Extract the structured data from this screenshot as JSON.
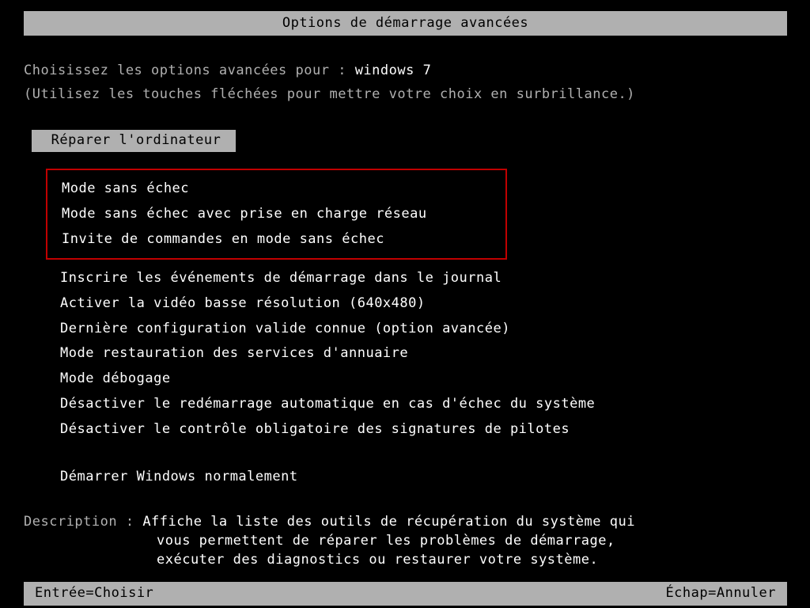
{
  "title": "Options de démarrage avancées",
  "prompt_prefix": "Choisissez les options avancées pour :",
  "os_name": "windows 7",
  "hint": "(Utilisez les touches fléchées pour mettre votre choix en surbrillance.)",
  "repair": "Réparer l'ordinateur",
  "group1": {
    "opt0": "Mode sans échec",
    "opt1": "Mode sans échec avec prise en charge réseau",
    "opt2": "Invite de commandes en mode sans échec"
  },
  "group2": {
    "opt0": "Inscrire les événements de démarrage dans le journal",
    "opt1": "Activer la vidéo basse résolution (640x480)",
    "opt2": "Dernière configuration valide connue (option avancée)",
    "opt3": "Mode restauration des services d'annuaire",
    "opt4": "Mode débogage",
    "opt5": "Désactiver le redémarrage automatique en cas d'échec du système",
    "opt6": "Désactiver le contrôle obligatoire des signatures de pilotes"
  },
  "group3": {
    "opt0": "Démarrer Windows normalement"
  },
  "description_label": "Description :",
  "description_line1": "Affiche la liste des outils de récupération du système qui",
  "description_line2": "vous permettent de réparer les problèmes de démarrage,",
  "description_line3": "exécuter des diagnostics ou restaurer votre système.",
  "footer_enter": "Entrée=Choisir",
  "footer_escape": "Échap=Annuler"
}
